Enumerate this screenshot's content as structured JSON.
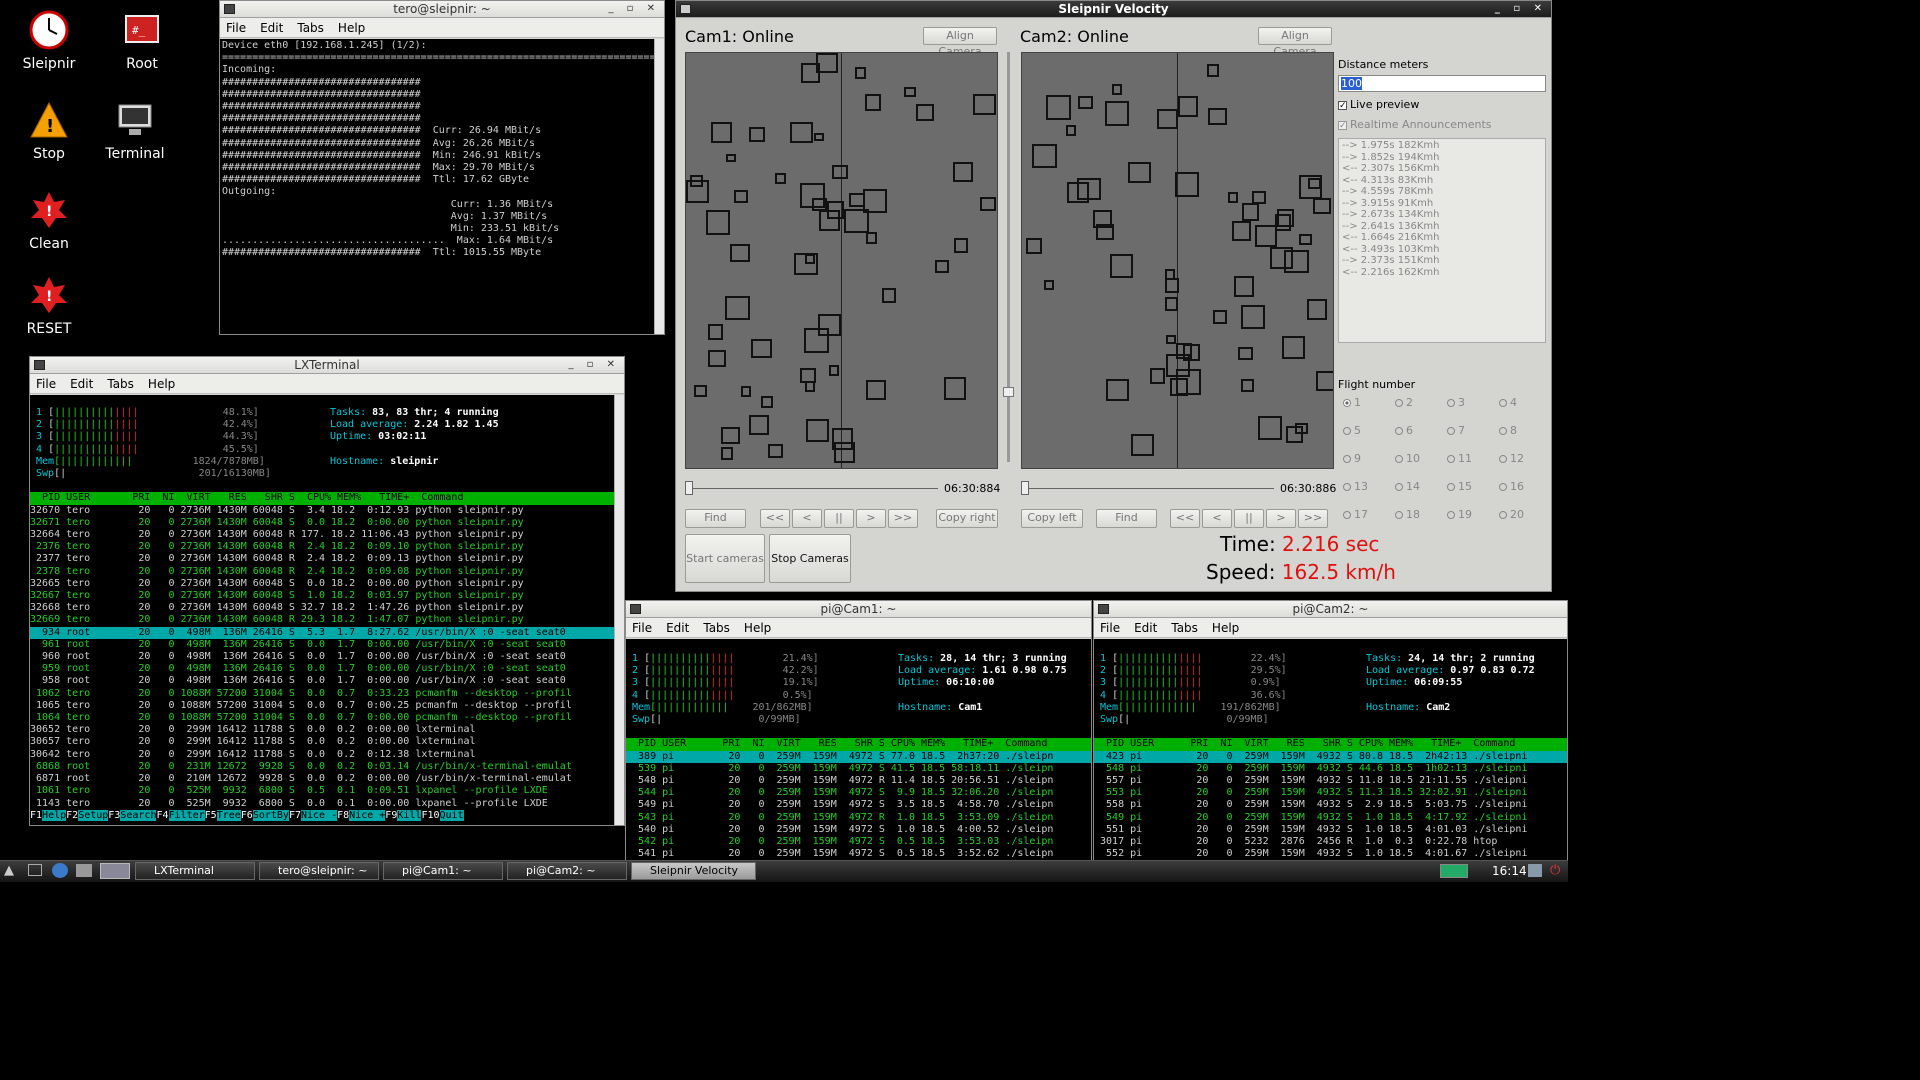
{
  "desktop": {
    "icons": [
      {
        "label": "Sleipnir",
        "icon": "clock-icon"
      },
      {
        "label": "Root",
        "icon": "root-terminal-icon"
      },
      {
        "label": "Stop",
        "icon": "warning-icon"
      },
      {
        "label": "Terminal",
        "icon": "monitor-icon"
      },
      {
        "label": "Clean",
        "icon": "red-alert-icon"
      },
      {
        "label": "RESET",
        "icon": "red-alert-icon"
      }
    ]
  },
  "menu": {
    "file": "File",
    "edit": "Edit",
    "tabs": "Tabs",
    "help": "Help"
  },
  "nload": {
    "title": "tero@sleipnir: ~",
    "lines": [
      "Device eth0 [192.168.1.245] (1/2):",
      "================================================================================",
      "Incoming:",
      "#################################",
      "#################################",
      "#################################",
      "#################################",
      "#################################  Curr: 26.94 MBit/s",
      "#################################  Avg: 26.26 MBit/s",
      "#################################  Min: 246.91 kBit/s",
      "#################################  Max: 29.70 MBit/s",
      "#################################  Ttl: 17.62 GByte",
      "Outgoing:",
      "",
      "",
      "",
      "",
      "",
      "",
      "                                      Curr: 1.36 MBit/s",
      "                                      Avg: 1.37 MBit/s",
      "                                      Min: 233.51 kBit/s",
      ".....................................  Max: 1.64 MBit/s",
      "#################################  Ttl: 1015.55 MByte"
    ]
  },
  "lxterm": {
    "title": "LXTerminal",
    "meters": [
      {
        "n": "1",
        "pct": "48.1%]"
      },
      {
        "n": "2",
        "pct": "42.4%]"
      },
      {
        "n": "3",
        "pct": "44.3%]"
      },
      {
        "n": "4",
        "pct": "45.5%]"
      }
    ],
    "mem_label": "Mem",
    "mem": "1824/7878MB]",
    "swp_label": "Swp",
    "swp": "201/16130MB]",
    "tasks_label": "Tasks:",
    "tasks": "83, 83 thr; 4 running",
    "load_label": "Load average:",
    "load": "2.24 1.82 1.45",
    "uptime_label": "Uptime:",
    "uptime": "03:02:11",
    "hostname_label": "Hostname:",
    "hostname": "sleipnir",
    "header": "  PID USER       PRI  NI  VIRT   RES   SHR S  CPU% MEM%   TIME+  Command",
    "rows": [
      "32670 tero        20   0 2736M 1430M 60048 S  3.4 18.2  0:12.93 python sleipnir.py",
      "32671 tero        20   0 2736M 1430M 60048 S  0.0 18.2  0:00.00 python sleipnir.py",
      "32664 tero        20   0 2736M 1430M 60048 R 177. 18.2 11:06.43 python sleipnir.py",
      " 2376 tero        20   0 2736M 1430M 60048 R  2.4 18.2  0:09.10 python sleipnir.py",
      " 2377 tero        20   0 2736M 1430M 60048 R  2.4 18.2  0:09.13 python sleipnir.py",
      " 2378 tero        20   0 2736M 1430M 60048 R  2.4 18.2  0:09.08 python sleipnir.py",
      "32665 tero        20   0 2736M 1430M 60048 S  0.0 18.2  0:00.00 python sleipnir.py",
      "32667 tero        20   0 2736M 1430M 60048 S  1.0 18.2  0:03.97 python sleipnir.py",
      "32668 tero        20   0 2736M 1430M 60048 S 32.7 18.2  1:47.26 python sleipnir.py",
      "32669 tero        20   0 2736M 1430M 60048 R 29.3 18.2  1:47.07 python sleipnir.py",
      "  934 root        20   0  498M  136M 26416 S  5.3  1.7  8:27.62 /usr/bin/X :0 -seat seat0",
      "  961 root        20   0  498M  136M 26416 S  0.0  1.7  0:00.00 /usr/bin/X :0 -seat seat0",
      "  960 root        20   0  498M  136M 26416 S  0.0  1.7  0:00.00 /usr/bin/X :0 -seat seat0",
      "  959 root        20   0  498M  136M 26416 S  0.0  1.7  0:00.00 /usr/bin/X :0 -seat seat0",
      "  958 root        20   0  498M  136M 26416 S  0.0  1.7  0:00.00 /usr/bin/X :0 -seat seat0",
      " 1062 tero        20   0 1088M 57200 31004 S  0.0  0.7  0:33.23 pcmanfm --desktop --profil",
      " 1065 tero        20   0 1088M 57200 31004 S  0.0  0.7  0:00.25 pcmanfm --desktop --profil",
      " 1064 tero        20   0 1088M 57200 31004 S  0.0  0.7  0:00.00 pcmanfm --desktop --profil",
      "30652 tero        20   0  299M 16412 11788 S  0.0  0.2  0:00.00 lxterminal",
      "30657 tero        20   0  299M 16412 11788 S  0.0  0.2  0:00.00 lxterminal",
      "30642 tero        20   0  299M 16412 11788 S  0.0  0.2  0:12.38 lxterminal",
      " 6868 root        20   0  231M 12672  9928 S  0.0  0.2  0:03.14 /usr/bin/x-terminal-emulat",
      " 6871 root        20   0  210M 12672  9928 S  0.0  0.2  0:00.00 /usr/bin/x-terminal-emulat",
      " 1061 tero        20   0  525M  9932  6800 S  0.5  0.1  0:09.51 lxpanel --profile LXDE",
      " 1143 tero        20   0  525M  9932  6800 S  0.0  0.1  0:00.00 lxpanel --profile LXDE"
    ],
    "fkeys": [
      [
        "F1",
        "Help"
      ],
      [
        "F2",
        "Setup"
      ],
      [
        "F3",
        "Search"
      ],
      [
        "F4",
        "Filter"
      ],
      [
        "F5",
        "Tree"
      ],
      [
        "F6",
        "SortBy"
      ],
      [
        "F7",
        "Nice -"
      ],
      [
        "F8",
        "Nice +"
      ],
      [
        "F9",
        "Kill"
      ],
      [
        "F10",
        "Quit"
      ]
    ]
  },
  "velocity": {
    "title": "Sleipnir Velocity",
    "cam1_status": "Cam1: Online",
    "cam2_status": "Cam2: Online",
    "align_camera": "Align Camera",
    "cam1_time": "06:30:884",
    "cam2_time": "06:30:886",
    "find": "Find",
    "nav": [
      "<<",
      "<",
      "||",
      ">",
      ">>"
    ],
    "copy_right": "Copy right",
    "copy_left": "Copy left",
    "start_cameras": "Start cameras",
    "stop_cameras": "Stop Cameras",
    "distance_label": "Distance meters",
    "distance_value": "100",
    "live_preview": "Live preview",
    "realtime": "Realtime Announcements",
    "log": [
      "--> 1.975s 182Kmh",
      "--> 1.852s 194Kmh",
      "<-- 2.307s 156Kmh",
      "<-- 4.313s 83Kmh",
      "--> 4.559s 78Kmh",
      "--> 3.915s 91Kmh",
      "--> 2.673s 134Kmh",
      "--> 2.641s 136Kmh",
      "<-- 1.664s 216Kmh",
      "<-- 3.493s 103Kmh",
      "--> 2.373s 151Kmh",
      "<-- 2.216s 162Kmh"
    ],
    "flight_label": "Flight number",
    "flights": [
      "1",
      "2",
      "3",
      "4",
      "5",
      "6",
      "7",
      "8",
      "9",
      "10",
      "11",
      "12",
      "13",
      "14",
      "15",
      "16",
      "17",
      "18",
      "19",
      "20"
    ],
    "time_label": "Time:",
    "time_value": "2.216 sec",
    "speed_label": "Speed:",
    "speed_value": "162.5 km/h",
    "accent": "#e01010"
  },
  "cam1term": {
    "title": "pi@Cam1: ~",
    "meters": [
      "21.4%]",
      "42.2%]",
      "19.1%]",
      "0.5%]"
    ],
    "mem": "201/862MB]",
    "swp": "0/99MB]",
    "tasks": "28, 14 thr; 3 running",
    "load": "1.61 0.98 0.75",
    "uptime": "06:10:00",
    "hostname": "Cam1",
    "header": "  PID USER      PRI  NI  VIRT   RES   SHR S CPU% MEM%   TIME+  Command",
    "rows": [
      "  389 pi         20   0  259M  159M  4972 S 77.0 18.5  2h37:20 ./sleipn",
      "  539 pi         20   0  259M  159M  4972 S 41.5 18.5 58:18.11 ./sleipn",
      "  548 pi         20   0  259M  159M  4972 R 11.4 18.5 20:56.51 ./sleipn",
      "  544 pi         20   0  259M  159M  4972 S  9.9 18.5 32:06.20 ./sleipn",
      "  549 pi         20   0  259M  159M  4972 S  3.5 18.5  4:58.70 ./sleipn",
      "  543 pi         20   0  259M  159M  4972 R  1.0 18.5  3:53.09 ./sleipn",
      "  540 pi         20   0  259M  159M  4972 S  1.0 18.5  4:00.52 ./sleipn",
      "  542 pi         20   0  259M  159M  4972 S  0.5 18.5  3:53.03 ./sleipn",
      "  541 pi         20   0  259M  159M  4972 S  0.5 18.5  3:52.62 ./sleipn"
    ]
  },
  "cam2term": {
    "title": "pi@Cam2: ~",
    "meters": [
      "22.4%]",
      "29.5%]",
      "0.9%]",
      "36.6%]"
    ],
    "mem": "191/862MB]",
    "swp": "0/99MB]",
    "tasks": "24, 14 thr; 2 running",
    "load": "0.97 0.83 0.72",
    "uptime": "06:09:55",
    "hostname": "Cam2",
    "header": "  PID USER      PRI  NI  VIRT   RES   SHR S CPU% MEM%   TIME+  Command",
    "rows": [
      "  423 pi         20   0  259M  159M  4932 S 80.8 18.5  2h42:13 ./sleipni",
      "  548 pi         20   0  259M  159M  4932 S 44.6 18.5  1h02:13 ./sleipni",
      "  557 pi         20   0  259M  159M  4932 S 11.8 18.5 21:11.55 ./sleipni",
      "  553 pi         20   0  259M  159M  4932 S 11.3 18.5 32:02.91 ./sleipni",
      "  558 pi         20   0  259M  159M  4932 S  2.9 18.5  5:03.75 ./sleipni",
      "  549 pi         20   0  259M  159M  4932 S  1.0 18.5  4:17.92 ./sleipni",
      "  551 pi         20   0  259M  159M  4932 S  1.0 18.5  4:01.03 ./sleipni",
      " 3017 pi         20   0  5232  2876  2456 R  1.0  0.3  0:22.78 htop",
      "  552 pi         20   0  259M  159M  4932 S  1.0 18.5  4:01.67 ./sleipni"
    ]
  },
  "taskbar": {
    "items": [
      "LXTerminal",
      "tero@sleipnir: ~",
      "pi@Cam1: ~",
      "pi@Cam2: ~",
      "Sleipnir Velocity"
    ],
    "clock": "16:14"
  }
}
